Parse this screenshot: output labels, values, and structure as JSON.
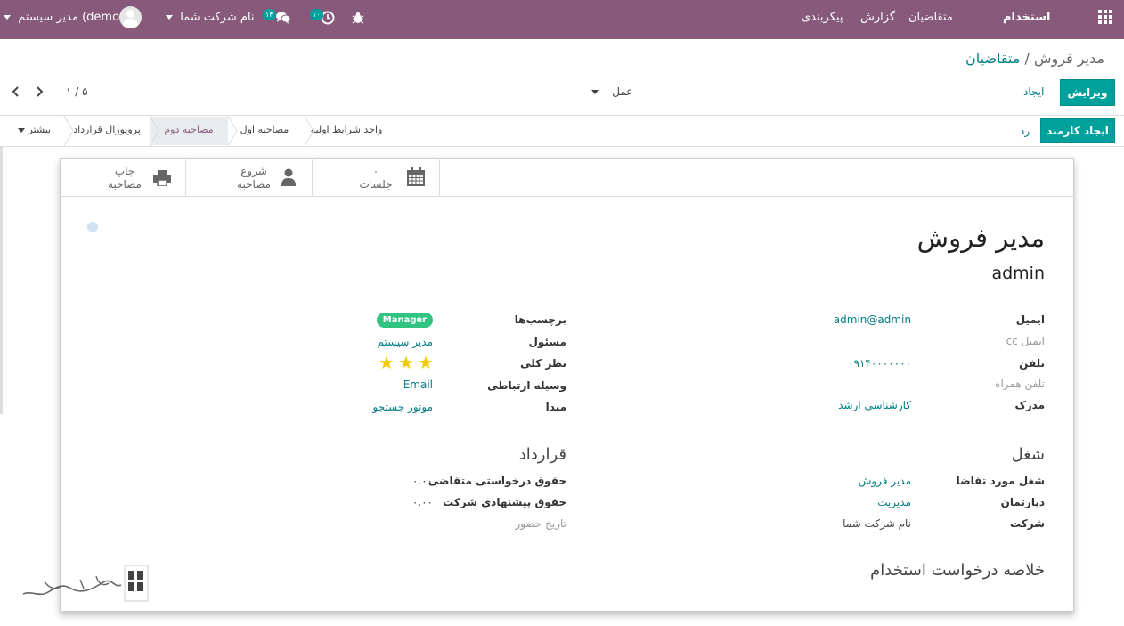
{
  "topbar": {
    "app_title": "استخدام",
    "menu": [
      "متقاضیان",
      "گزارش",
      "پیکربندی"
    ],
    "company": "نام شرکت شما",
    "user": "مدیر سیستم (demo)",
    "messages_count": "۱۴",
    "activities_count": "۱۰",
    "bg": "#875a7b"
  },
  "breadcrumb": {
    "parent": "متقاضیان",
    "separator": "/",
    "current": "مدیر فروش"
  },
  "buttons": {
    "edit": "ویرایش",
    "create": "ایجاد",
    "action": "عمل"
  },
  "pager": {
    "value": "۱ / ۵"
  },
  "status": {
    "create_employee": "ایجاد کارمند",
    "refuse": "رد",
    "stages": [
      "واجد شرایط اولیه",
      "مصاحبه اول",
      "مصاحبه دوم",
      "پروپوزال قرارداد"
    ],
    "active_stage": "مصاحبه دوم",
    "more": "بیشتر"
  },
  "smart_buttons": {
    "meetings_count": "۰",
    "meetings_label": "جلسات",
    "interview_start_1": "شروع",
    "interview_start_2": "مصاحبه",
    "interview_print_1": "چاپ",
    "interview_print_2": "مصاحبه"
  },
  "form": {
    "title": "مدیر فروش",
    "applicant_name": "admin",
    "right": {
      "email_label": "ایمیل",
      "email": "admin@admin",
      "cc_label": "ایمیل cc",
      "phone_label": "تلفن",
      "phone": "۰۹۱۴۰۰۰۰۰۰۰",
      "mobile_label": "تلفن همراه",
      "degree_label": "مدرک",
      "degree": "کارشناسی ارشد"
    },
    "left": {
      "tags_label": "برچسب‌ها",
      "tag": "Manager",
      "responsible_label": "مسئول",
      "responsible": "مدیر سیستم",
      "rating_label": "نظر کلی",
      "rating": 3,
      "medium_label": "وسیله ارتباطی",
      "medium": "Email",
      "source_label": "مبدا",
      "source": "موتور جستجو"
    },
    "job": {
      "title": "شغل",
      "applied_job_label": "شغل مورد تقاضا",
      "applied_job": "مدیر فروش",
      "department_label": "دپارتمان",
      "department": "مدیریت",
      "company_label": "شرکت",
      "company": "نام شرکت شما"
    },
    "contract": {
      "title": "قرارداد",
      "expected_salary_label": "حقوق درخواستی متقاضی",
      "expected_salary": "۰.۰۰",
      "proposed_salary_label": "حقوق پیشنهادی شرکت",
      "proposed_salary": "۰.۰۰",
      "availability_label": "تاریخ حضور"
    },
    "summary_title": "خلاصه درخواست استخدام"
  },
  "colors": {
    "primary": "#00a09d",
    "tag": "#30c381",
    "star": "#f3cc00",
    "link": "#017e84"
  }
}
